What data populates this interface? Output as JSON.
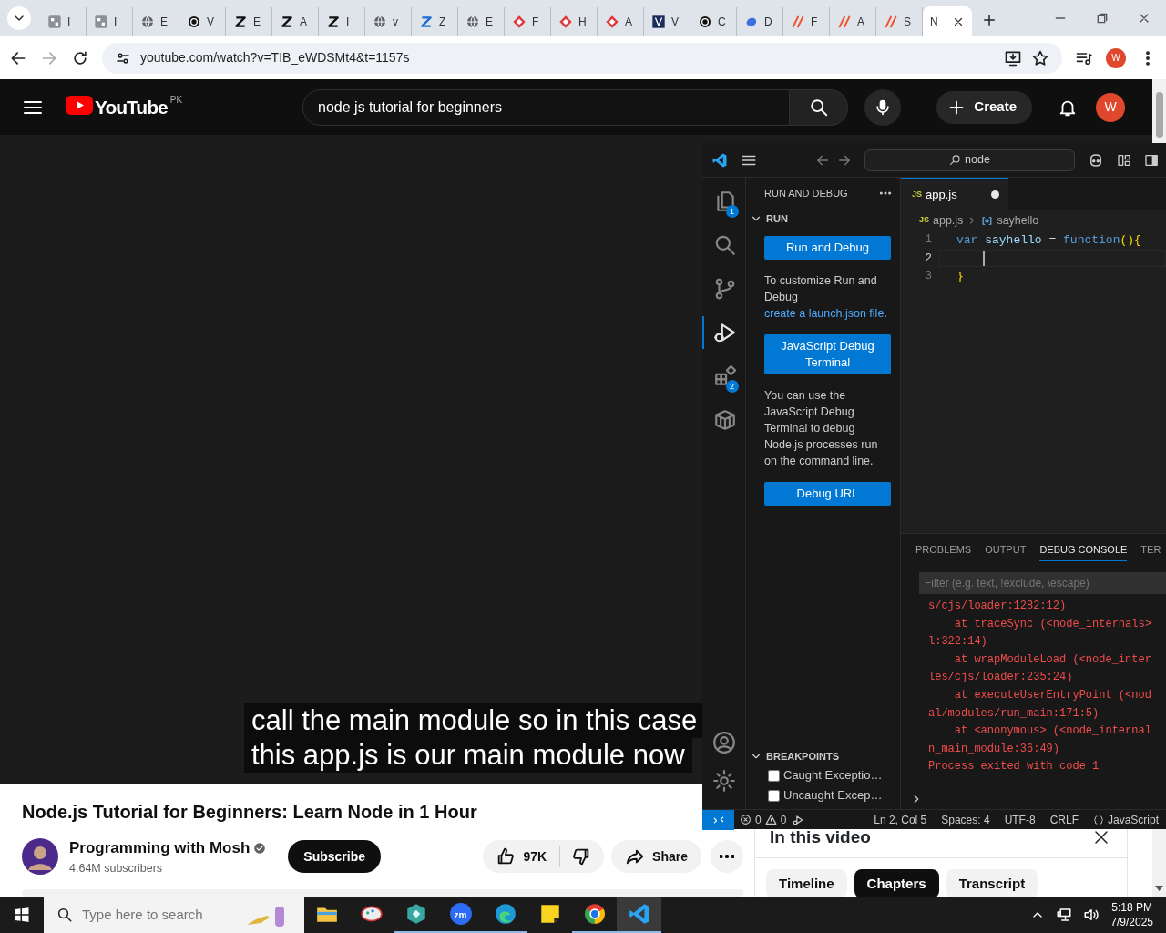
{
  "browser": {
    "tabs": [
      {
        "title": "I",
        "selected": false
      },
      {
        "title": "I",
        "selected": false
      },
      {
        "title": "E",
        "selected": false
      },
      {
        "title": "V",
        "selected": false
      },
      {
        "title": "E",
        "selected": false
      },
      {
        "title": "A",
        "selected": false
      },
      {
        "title": "I",
        "selected": false
      },
      {
        "title": "v",
        "selected": false
      },
      {
        "title": "Z",
        "selected": false
      },
      {
        "title": "E",
        "selected": false
      },
      {
        "title": "F",
        "selected": false
      },
      {
        "title": "H",
        "selected": false
      },
      {
        "title": "A",
        "selected": false
      },
      {
        "title": "V",
        "selected": false
      },
      {
        "title": "C",
        "selected": false
      },
      {
        "title": "D",
        "selected": false
      },
      {
        "title": "F",
        "selected": false
      },
      {
        "title": "A",
        "selected": false
      },
      {
        "title": "S",
        "selected": false
      },
      {
        "title": "N",
        "selected": true
      }
    ],
    "address": "youtube.com/watch?v=TIB_eWDSMt4&t=1157s",
    "profile": "W"
  },
  "youtube": {
    "logo": "YouTube",
    "country": "PK",
    "search": {
      "value": "node js tutorial for beginners"
    },
    "create": "Create",
    "avatar": "W",
    "captions": [
      "call the main module so in this case",
      "this app.js is our main module now"
    ],
    "title": "Node.js Tutorial for Beginners: Learn Node in 1 Hour",
    "channel": {
      "name": "Programming with Mosh",
      "verified": true,
      "subscribers": "4.64M subscribers"
    },
    "subscribe": "Subscribe",
    "likes": "97K",
    "share": "Share",
    "chapters_panel": {
      "title": "In this video",
      "tabs": [
        {
          "label": "Timeline",
          "selected": false
        },
        {
          "label": "Chapters",
          "selected": true
        },
        {
          "label": "Transcript",
          "selected": false
        }
      ]
    }
  },
  "vscode": {
    "command_center": "node",
    "activity": [
      {
        "kind": "files",
        "badge": "1",
        "selected": false
      },
      {
        "kind": "search",
        "selected": false
      },
      {
        "kind": "scm",
        "selected": false
      },
      {
        "kind": "run",
        "selected": true
      },
      {
        "kind": "extensions",
        "badge": "2",
        "selected": false
      },
      {
        "kind": "box",
        "selected": false
      }
    ],
    "sidebar": {
      "title": "RUN AND DEBUG",
      "section": "RUN",
      "blocks": [
        {
          "kind": "button",
          "text": "Run and Debug"
        },
        {
          "kind": "text",
          "text": "To customize Run and Debug ",
          "link": "create a launch.json file",
          "after": "."
        },
        {
          "kind": "button",
          "text": "JavaScript Debug Terminal"
        },
        {
          "kind": "text",
          "text": "You can use the JavaScript Debug Terminal to debug Node.js processes run on the command line."
        },
        {
          "kind": "button",
          "text": "Debug URL"
        }
      ],
      "breakpoints": {
        "title": "BREAKPOINTS",
        "items": [
          {
            "label": "Caught Exceptio…",
            "checked": false
          },
          {
            "label": "Uncaught Excep…",
            "checked": false
          }
        ]
      }
    },
    "editor": {
      "tab": {
        "icon_text": "JS",
        "label": "app.js",
        "dirty": true
      },
      "breadcrumb": {
        "icon_text": "JS",
        "file": "app.js",
        "symbol": "sayhello"
      },
      "lines": [
        {
          "number": "1",
          "current": false,
          "tokens": [
            {
              "text": "var",
              "kind": "keyword"
            },
            {
              "text": " sayhello",
              "kind": "variable"
            },
            {
              "text": " = ",
              "kind": "operator"
            },
            {
              "text": "function",
              "kind": "keyword"
            },
            {
              "text": "(){",
              "kind": "bracket"
            }
          ]
        },
        {
          "number": "2",
          "current": true
        },
        {
          "number": "3",
          "current": false,
          "tokens": [
            {
              "text": "}",
              "kind": "bracket"
            }
          ]
        }
      ]
    },
    "panel": {
      "tabs": [
        {
          "label": "PROBLEMS",
          "selected": false
        },
        {
          "label": "OUTPUT",
          "selected": false
        },
        {
          "label": "DEBUG CONSOLE",
          "selected": true
        },
        {
          "label": "TER",
          "selected": false
        }
      ],
      "filter_placeholder": "Filter (e.g. text, !exclude, \\escape)",
      "lines": [
        "s/cjs/loader:1282:12)",
        "    at traceSync (<node_internals>",
        "l:322:14)",
        "    at wrapModuleLoad (<node_inter",
        "les/cjs/loader:235:24)",
        "    at executeUserEntryPoint (<nod",
        "al/modules/run_main:171:5)",
        "    at <anonymous> (<node_internal",
        "n_main_module:36:49)",
        "Process exited with code 1"
      ]
    },
    "status_bar": {
      "errors": "0",
      "warnings": "0",
      "items": [
        "Ln 2, Col 5",
        "Spaces: 4",
        "UTF-8",
        "CRLF"
      ],
      "language": "JavaScript"
    }
  },
  "taskbar": {
    "search_placeholder": "Type here to search",
    "apps": [
      {
        "kind": "folder",
        "running": false,
        "selected": false
      },
      {
        "kind": "paint",
        "running": false,
        "selected": false
      },
      {
        "kind": "teal",
        "running": true,
        "selected": false
      },
      {
        "kind": "zoom",
        "label": "zm",
        "running": true,
        "selected": false
      },
      {
        "kind": "edge",
        "running": true,
        "selected": false
      },
      {
        "kind": "note",
        "running": false,
        "selected": false
      },
      {
        "kind": "chrome",
        "running": true,
        "selected": false
      },
      {
        "kind": "vscode",
        "running": true,
        "selected": true
      }
    ],
    "time": "5:18 PM",
    "date": "7/9/2025"
  }
}
